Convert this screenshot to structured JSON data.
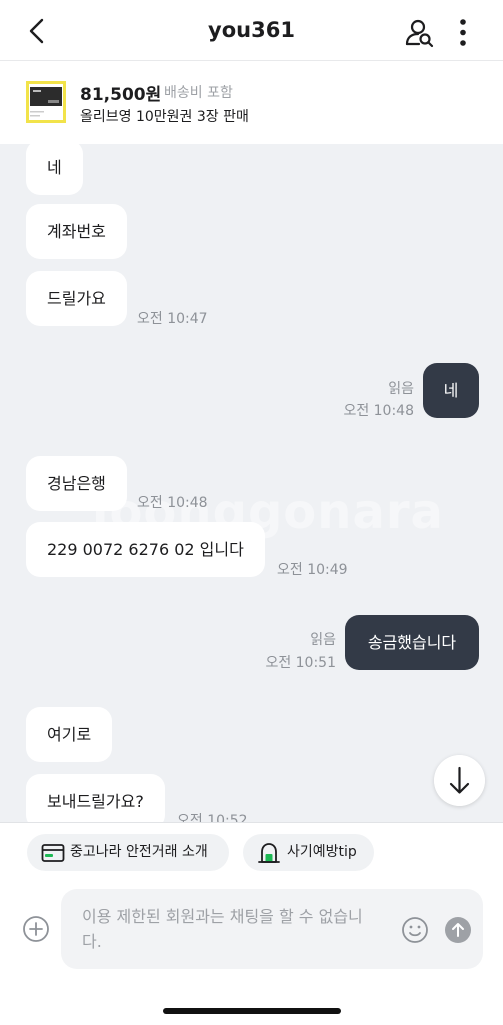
{
  "header": {
    "title": "you361"
  },
  "product": {
    "price": "81,500원",
    "shipping": "배송비 포함",
    "name": "올리브영 10만원권 3장 판매"
  },
  "messages": [
    {
      "text": "네"
    },
    {
      "text": "계좌번호"
    },
    {
      "text": "드릴가요",
      "time": "오전 10:47"
    },
    {
      "text": "네",
      "read": "읽음",
      "time": "오전 10:48"
    },
    {
      "text": "경남은행",
      "time": "오전 10:48"
    },
    {
      "text": "229 0072 6276 02 입니다",
      "time": "오전 10:49"
    },
    {
      "text": "송금했습니다",
      "read": "읽음",
      "time": "오전 10:51"
    },
    {
      "text": "여기로"
    },
    {
      "text": "보내드릴가요?",
      "time": "오전 10:52"
    }
  ],
  "watermark": "joonggonara",
  "chips": [
    {
      "label": "중고나라 안전거래 소개",
      "icon": "card-icon"
    },
    {
      "label": "사기예방tip",
      "icon": "lock-icon"
    }
  ],
  "input": {
    "placeholder": "이용 제한된 회원과는 채팅을 할 수 없습니다."
  },
  "colors": {
    "my_bubble": "#333a47",
    "chat_bg": "#eff1f4",
    "accent_green": "#1db954"
  }
}
